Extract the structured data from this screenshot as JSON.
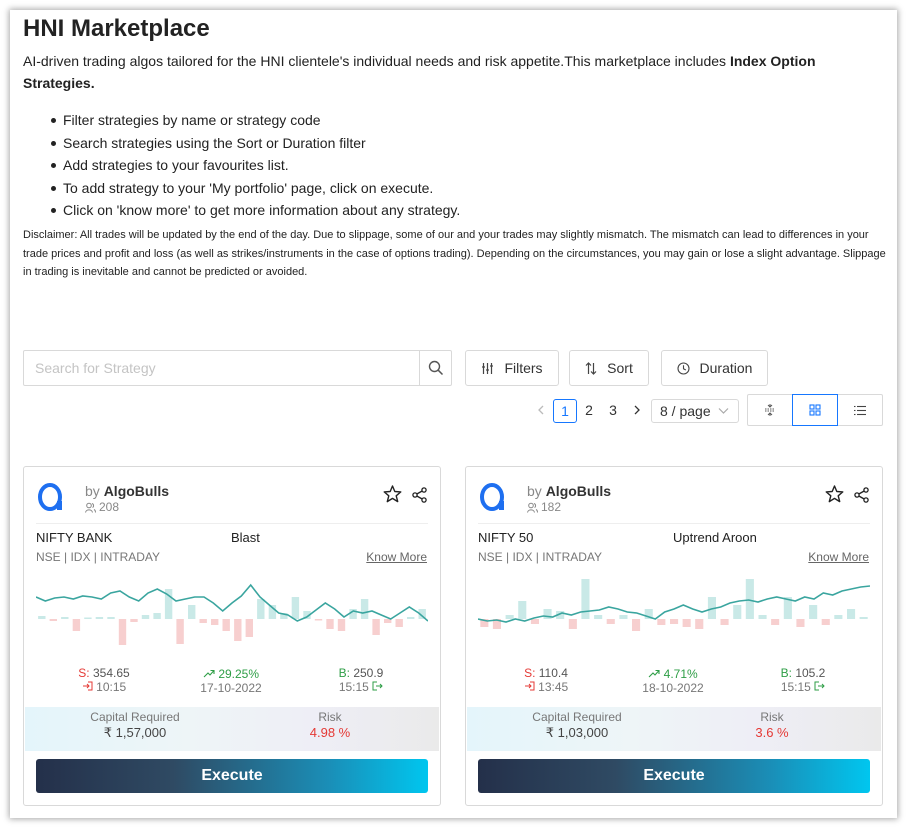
{
  "page": {
    "title": "HNI Marketplace",
    "intro": "AI-driven trading algos tailored for the HNI clientele's individual needs and risk appetite.This marketplace includes ",
    "intro_bold": "Index Option Strategies.",
    "bullets": [
      "Filter strategies by name or strategy code",
      "Search strategies using the Sort or Duration filter",
      "Add strategies to your favourites list.",
      "To add strategy to your 'My portfolio' page, click on execute.",
      "Click on 'know more' to get more information about any strategy."
    ],
    "disclaimer": "Disclaimer: All trades will be updated by the end of the day. Due to slippage, some of our and your trades may slightly mismatch. The mismatch can lead to differences in your trade prices and profit and loss (as well as strikes/instruments in the case of options trading). Depending on the circumstances, you may gain or lose a slight advantage. Slippage in trading is inevitable and cannot be predicted or avoided."
  },
  "toolbar": {
    "search_placeholder": "Search for Strategy",
    "filters_label": "Filters",
    "sort_label": "Sort",
    "duration_label": "Duration"
  },
  "pagination": {
    "pages": [
      "1",
      "2",
      "3"
    ],
    "current": "1",
    "per_page": "8 / page"
  },
  "cards": [
    {
      "by_prefix": "by",
      "author": "AlgoBulls",
      "subscribers": "208",
      "instrument": "NIFTY BANK",
      "strategy": "Blast",
      "exchange": "NSE | IDX | INTRADAY",
      "know_more": "Know More",
      "sell_label": "S:",
      "sell_price": "354.65",
      "entry_time": "10:15",
      "pnl_pct": "29.25%",
      "date": "17-10-2022",
      "buy_label": "B:",
      "buy_price": "250.9",
      "exit_time": "15:15",
      "capital_label": "Capital Required",
      "capital": "₹ 1,57,000",
      "risk_label": "Risk",
      "risk": "4.98 %",
      "execute_label": "Execute",
      "line": [
        62,
        58,
        61,
        62,
        60,
        63,
        62,
        60,
        66,
        68,
        62,
        58,
        66,
        70,
        65,
        58,
        60,
        62,
        62,
        56,
        48,
        56,
        63,
        74,
        62,
        54,
        46,
        44,
        38,
        42,
        49,
        56,
        50,
        42,
        48,
        46,
        48,
        44,
        40,
        46,
        52,
        46,
        38
      ],
      "bars": [
        {
          "v": 3,
          "up": true
        },
        {
          "v": 2,
          "up": false
        },
        {
          "v": 2,
          "up": true
        },
        {
          "v": 12,
          "up": false
        },
        {
          "v": 1,
          "up": true
        },
        {
          "v": 2,
          "up": true
        },
        {
          "v": 2,
          "up": true
        },
        {
          "v": 26,
          "up": false
        },
        {
          "v": 3,
          "up": false
        },
        {
          "v": 4,
          "up": true
        },
        {
          "v": 6,
          "up": true
        },
        {
          "v": 30,
          "up": true
        },
        {
          "v": 25,
          "up": false
        },
        {
          "v": 14,
          "up": true
        },
        {
          "v": 4,
          "up": false
        },
        {
          "v": 6,
          "up": false
        },
        {
          "v": 12,
          "up": false
        },
        {
          "v": 22,
          "up": false
        },
        {
          "v": 18,
          "up": false
        },
        {
          "v": 20,
          "up": true
        },
        {
          "v": 14,
          "up": true
        },
        {
          "v": 6,
          "up": true
        },
        {
          "v": 22,
          "up": true
        },
        {
          "v": 8,
          "up": true
        },
        {
          "v": 1,
          "up": false
        },
        {
          "v": 10,
          "up": false
        },
        {
          "v": 12,
          "up": false
        },
        {
          "v": 10,
          "up": true
        },
        {
          "v": 20,
          "up": true
        },
        {
          "v": 16,
          "up": false
        },
        {
          "v": 4,
          "up": false
        },
        {
          "v": 8,
          "up": false
        },
        {
          "v": 2,
          "up": true
        },
        {
          "v": 10,
          "up": true
        }
      ]
    },
    {
      "by_prefix": "by",
      "author": "AlgoBulls",
      "subscribers": "182",
      "instrument": "NIFTY 50",
      "strategy": "Uptrend Aroon",
      "exchange": "NSE | IDX | INTRADAY",
      "know_more": "Know More",
      "sell_label": "S:",
      "sell_price": "110.4",
      "entry_time": "13:45",
      "pnl_pct": "4.71%",
      "date": "18-10-2022",
      "buy_label": "B:",
      "buy_price": "105.2",
      "exit_time": "15:15",
      "capital_label": "Capital Required",
      "capital": "₹ 1,03,000",
      "risk_label": "Risk",
      "risk": "3.6 %",
      "execute_label": "Execute",
      "line": [
        40,
        38,
        39,
        37,
        40,
        38,
        41,
        43,
        42,
        46,
        44,
        47,
        48,
        49,
        52,
        50,
        47,
        46,
        43,
        40,
        47,
        50,
        54,
        50,
        47,
        50,
        52,
        56,
        58,
        59,
        57,
        60,
        62,
        60,
        58,
        62,
        60,
        66,
        64,
        68,
        70,
        72,
        73
      ],
      "bars": [
        {
          "v": 8,
          "up": false
        },
        {
          "v": 10,
          "up": false
        },
        {
          "v": 4,
          "up": true
        },
        {
          "v": 18,
          "up": true
        },
        {
          "v": 5,
          "up": false
        },
        {
          "v": 10,
          "up": true
        },
        {
          "v": 8,
          "up": true
        },
        {
          "v": 10,
          "up": false
        },
        {
          "v": 40,
          "up": true
        },
        {
          "v": 4,
          "up": true
        },
        {
          "v": 5,
          "up": false
        },
        {
          "v": 4,
          "up": true
        },
        {
          "v": 12,
          "up": false
        },
        {
          "v": 10,
          "up": true
        },
        {
          "v": 6,
          "up": false
        },
        {
          "v": 5,
          "up": false
        },
        {
          "v": 8,
          "up": false
        },
        {
          "v": 10,
          "up": false
        },
        {
          "v": 22,
          "up": true
        },
        {
          "v": 6,
          "up": false
        },
        {
          "v": 14,
          "up": true
        },
        {
          "v": 40,
          "up": true
        },
        {
          "v": 4,
          "up": true
        },
        {
          "v": 6,
          "up": false
        },
        {
          "v": 22,
          "up": true
        },
        {
          "v": 8,
          "up": false
        },
        {
          "v": 14,
          "up": true
        },
        {
          "v": 6,
          "up": false
        },
        {
          "v": 4,
          "up": true
        },
        {
          "v": 10,
          "up": true
        },
        {
          "v": 2,
          "up": true
        }
      ]
    }
  ],
  "colors": {
    "line": "#3aa59f",
    "bar_up": "#c9e9e7",
    "bar_down": "#f7cfcf",
    "accent": "#1677ff"
  }
}
